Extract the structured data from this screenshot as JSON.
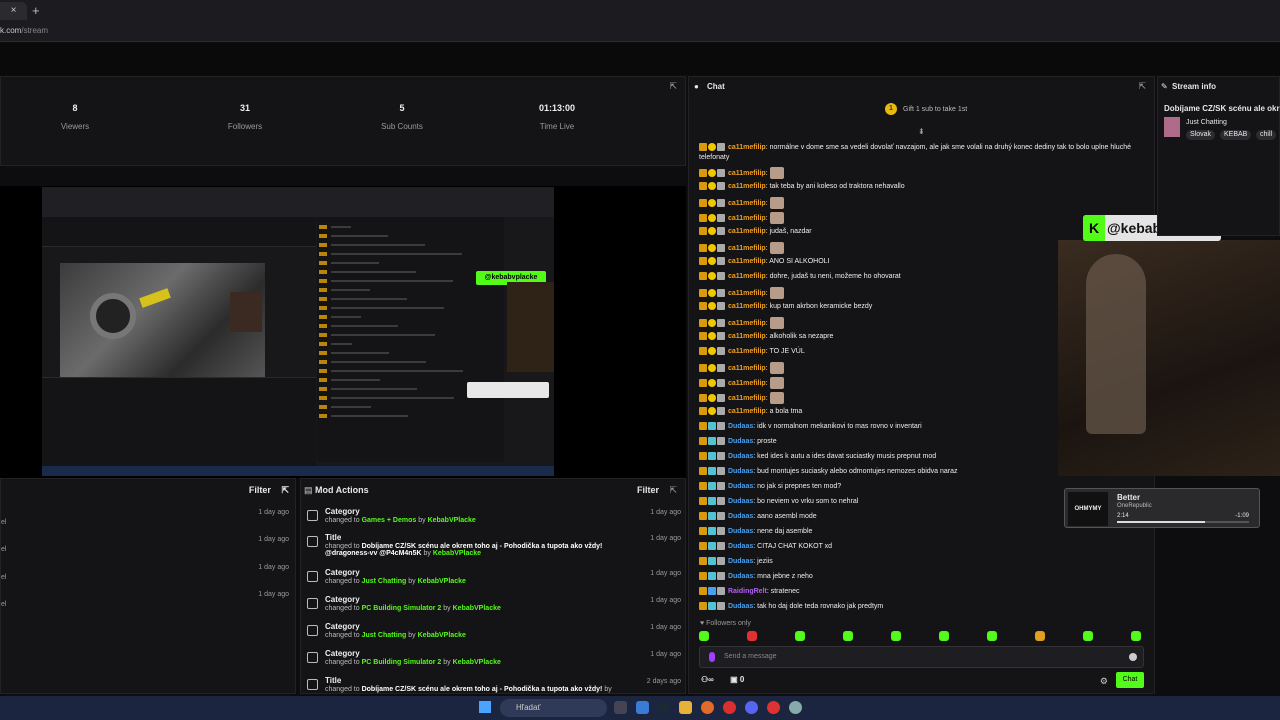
{
  "browser": {
    "tab_close": "×",
    "new_tab": "+",
    "url_host": "k.com",
    "url_path": "/stream"
  },
  "stats": [
    {
      "value": "8",
      "label": "Viewers"
    },
    {
      "value": "31",
      "label": "Followers"
    },
    {
      "value": "5",
      "label": "Sub Counts"
    },
    {
      "value": "01:13:00",
      "label": "Time Live"
    }
  ],
  "left_list": {
    "filter": "Filter",
    "ago": [
      "1 day ago",
      "1 day ago",
      "1 day ago",
      "1 day ago"
    ],
    "edge": "el"
  },
  "mod_actions": {
    "title": "Mod Actions",
    "filter": "Filter",
    "items": [
      {
        "title": "Category",
        "pre": "changed to ",
        "target": "Games + Demos",
        "by": " by ",
        "user": "KebabVPlacke",
        "ago": "1 day ago"
      },
      {
        "title": "Title",
        "pre": "changed to ",
        "target": "Dobíjame CZ/SK scénu ale okrem toho aj - Pohodička a tupota ako vždy! @dragoness-vv @P4cM4n5K",
        "by": " by ",
        "user": "KebabVPlacke",
        "ago": "1 day ago"
      },
      {
        "title": "Category",
        "pre": "changed to ",
        "target": "Just Chatting",
        "by": " by ",
        "user": "KebabVPlacke",
        "ago": "1 day ago"
      },
      {
        "title": "Category",
        "pre": "changed to ",
        "target": "PC Building Simulator 2",
        "by": " by ",
        "user": "KebabVPlacke",
        "ago": "1 day ago"
      },
      {
        "title": "Category",
        "pre": "changed to ",
        "target": "Just Chatting",
        "by": " by ",
        "user": "KebabVPlacke",
        "ago": "1 day ago"
      },
      {
        "title": "Category",
        "pre": "changed to ",
        "target": "PC Building Simulator 2",
        "by": " by ",
        "user": "KebabVPlacke",
        "ago": "1 day ago"
      },
      {
        "title": "Title",
        "pre": "changed to ",
        "target": "Dobíjame CZ/SK scénu ale okrem toho aj - Pohodička a tupota ako vždy!",
        "by": " by ",
        "user": "KebabVPlacke",
        "ago": "2 days ago"
      }
    ]
  },
  "chat": {
    "title": "Chat",
    "gift_count": "1",
    "gift_text": "Gift 1 sub to take 1st",
    "followers_only": "Followers only",
    "placeholder": "Send a message",
    "viewers_count": "0",
    "chat_button": "Chat",
    "messages": [
      {
        "user": "ca11mefilip",
        "text": ": normálne v dome sme sa vedeli dovolať navzajom, ale jak sme volali na druhý konec dediny tak to bolo uplne hluché telefonaty",
        "color": "#f0a020",
        "badge": "b2",
        "emote": false
      },
      {
        "user": "ca11mefilip",
        "text": ":",
        "color": "#f0a020",
        "badge": "b2",
        "emote": true
      },
      {
        "user": "ca11mefilip",
        "text": ": tak teba by ani koleso od traktora nehavallo",
        "color": "#f0a020",
        "badge": "b2",
        "emote": false
      },
      {
        "user": "ca11mefilip",
        "text": ":",
        "color": "#f0a020",
        "badge": "b2",
        "emote": true
      },
      {
        "user": "ca11mefilip",
        "text": ":",
        "color": "#f0a020",
        "badge": "b2",
        "emote": true
      },
      {
        "user": "ca11mefilip",
        "text": ": judaš, nazdar",
        "color": "#f0a020",
        "badge": "b2",
        "emote": false
      },
      {
        "user": "ca11mefilip",
        "text": ":",
        "color": "#f0a020",
        "badge": "b2",
        "emote": true
      },
      {
        "user": "ca11mefilip",
        "text": ": ANO SI ALKOHOLI",
        "color": "#f0a020",
        "badge": "b2",
        "emote": false
      },
      {
        "user": "ca11mefilip",
        "text": ": dohre, judaš tu neni, možeme ho ohovarat",
        "color": "#f0a020",
        "badge": "b2",
        "emote": false
      },
      {
        "user": "ca11mefilip",
        "text": ":",
        "color": "#f0a020",
        "badge": "b2",
        "emote": true
      },
      {
        "user": "ca11mefilip",
        "text": ": kup tam akrbon keramicke bezdy",
        "color": "#f0a020",
        "badge": "b2",
        "emote": false
      },
      {
        "user": "ca11mefilip",
        "text": ":",
        "color": "#f0a020",
        "badge": "b2",
        "emote": true
      },
      {
        "user": "ca11mefilip",
        "text": ": alkoholik sa nezapre",
        "color": "#f0a020",
        "badge": "b2",
        "emote": false
      },
      {
        "user": "ca11mefilip",
        "text": ": TO JE VÚL",
        "color": "#f0a020",
        "badge": "b2",
        "emote": false
      },
      {
        "user": "ca11mefilip",
        "text": ":",
        "color": "#f0a020",
        "badge": "b2",
        "emote": true
      },
      {
        "user": "ca11mefilip",
        "text": ":",
        "color": "#f0a020",
        "badge": "b2",
        "emote": true
      },
      {
        "user": "ca11mefilip",
        "text": ":",
        "color": "#f0a020",
        "badge": "b2",
        "emote": true
      },
      {
        "user": "ca11mefilip",
        "text": ": a bola tma",
        "color": "#f0a020",
        "badge": "b2",
        "emote": false
      },
      {
        "user": "Dudaas",
        "text": ": idk v normalnom mekanikovi to mas rovno v inventari",
        "color": "#48a0f0",
        "badge": "b3",
        "emote": false
      },
      {
        "user": "Dudaas",
        "text": ": proste",
        "color": "#48a0f0",
        "badge": "b3",
        "emote": false
      },
      {
        "user": "Dudaas",
        "text": ": ked ides k autu a ides davat suciastky musis prepnut mod",
        "color": "#48a0f0",
        "badge": "b3",
        "emote": false
      },
      {
        "user": "Dudaas",
        "text": ": bud montujes suciasky alebo odmontujes nemozes obidva naraz",
        "color": "#48a0f0",
        "badge": "b3",
        "emote": false
      },
      {
        "user": "Dudaas",
        "text": ": no jak si prepnes ten mod?",
        "color": "#48a0f0",
        "badge": "b3",
        "emote": false
      },
      {
        "user": "Dudaas",
        "text": ": bo neviem vo vrku som to nehral",
        "color": "#48a0f0",
        "badge": "b3",
        "emote": false
      },
      {
        "user": "Dudaas",
        "text": ": aano asembl mode",
        "color": "#48a0f0",
        "badge": "b3",
        "emote": false
      },
      {
        "user": "Dudaas",
        "text": ": nene daj asemble",
        "color": "#48a0f0",
        "badge": "b3",
        "emote": false
      },
      {
        "user": "Dudaas",
        "text": ": CITAJ CHAT KOKOT xd",
        "color": "#48a0f0",
        "badge": "b3",
        "emote": false
      },
      {
        "user": "Dudaas",
        "text": ": jeziis",
        "color": "#48a0f0",
        "badge": "b3",
        "emote": false
      },
      {
        "user": "Dudaas",
        "text": ": mna jebne z neho",
        "color": "#48a0f0",
        "badge": "b3",
        "emote": false
      },
      {
        "user": "RaidingRelt",
        "text": ": stratenec",
        "color": "#b060f0",
        "badge": "b4",
        "emote": false
      },
      {
        "user": "Dudaas",
        "text": ": tak ho daj dole teda rovnako jak predtym",
        "color": "#48a0f0",
        "badge": "b3",
        "emote": false
      }
    ],
    "emote_colors": [
      "#53fc18",
      "#e03030",
      "#53fc18",
      "#53fc18",
      "#53fc18",
      "#53fc18",
      "#53fc18",
      "#e0a020",
      "#53fc18",
      "#53fc18"
    ]
  },
  "stream_info": {
    "title": "Stream info",
    "stream_title": "Dobíjame CZ/SK scénu ale okrem t",
    "category": "Just Chatting",
    "tags": [
      "Slovak",
      "KEBAB",
      "chill"
    ]
  },
  "overlay": {
    "handle": "@kebabvplacke",
    "k": "K",
    "song": "Better",
    "artist": "OneRepublic",
    "elapsed": "2:14",
    "remaining": "-1:09",
    "art_text": "OHMYMY",
    "progress": 0.67
  },
  "taskbar": {
    "search": "Hľadať"
  }
}
